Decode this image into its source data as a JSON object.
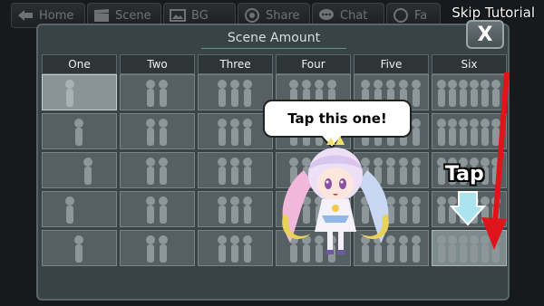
{
  "nav": {
    "items": [
      {
        "label": "Home",
        "icon": "arrow-left-icon"
      },
      {
        "label": "Scene",
        "icon": "clapperboard-icon"
      },
      {
        "label": "BG",
        "icon": "image-icon"
      },
      {
        "label": "Share",
        "icon": "share-icon"
      },
      {
        "label": "Chat",
        "icon": "chat-icon"
      },
      {
        "label": "Fa",
        "icon": "face-icon"
      }
    ],
    "skip_label": "Skip Tutorial"
  },
  "panel": {
    "title": "Scene Amount",
    "close_label": "X",
    "columns": [
      "One",
      "Two",
      "Three",
      "Four",
      "Five",
      "Six"
    ],
    "rows": 5,
    "selected_cell": "One row 1",
    "highlighted_cell": "Six row 5"
  },
  "tutorial": {
    "bubble_text": "Tap this one!",
    "tap_label": "Tap"
  },
  "colors": {
    "background": "#2b3133",
    "panel": "#394245",
    "cell": "#566062",
    "arrow_red": "#e0141b",
    "arrow_light_blue": "#a9e4f0"
  }
}
